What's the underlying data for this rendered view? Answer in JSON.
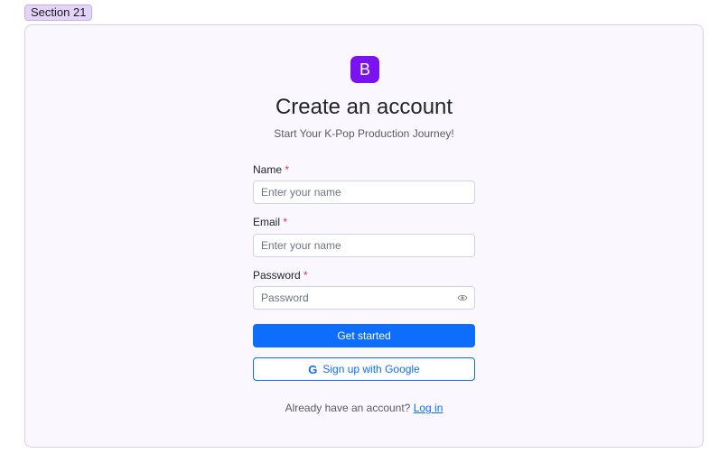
{
  "section_tag": "Section 21",
  "logo": {
    "letter": "B",
    "icon": "bootstrap-logo-icon",
    "color": "#7a13f0"
  },
  "title": "Create an account",
  "subtitle": "Start Your K-Pop Production Journey!",
  "required_marker": "*",
  "fields": {
    "name": {
      "label": "Name",
      "placeholder": "Enter your name",
      "value": ""
    },
    "email": {
      "label": "Email",
      "placeholder": "Enter your name",
      "value": ""
    },
    "password": {
      "label": "Password",
      "placeholder": "Password",
      "value": "",
      "toggle_icon": "eye-icon"
    }
  },
  "buttons": {
    "primary": {
      "label": "Get started",
      "color": "#0d6efd"
    },
    "google": {
      "label": "Sign up with Google",
      "icon": "google-icon",
      "icon_glyph": "G"
    }
  },
  "footer": {
    "text": "Already have an account?",
    "link": "Log in"
  },
  "colors": {
    "accent": "#0d6efd",
    "required": "#dc3545",
    "card_border": "#dccbf7",
    "tag_background": "#e4d4fa"
  }
}
